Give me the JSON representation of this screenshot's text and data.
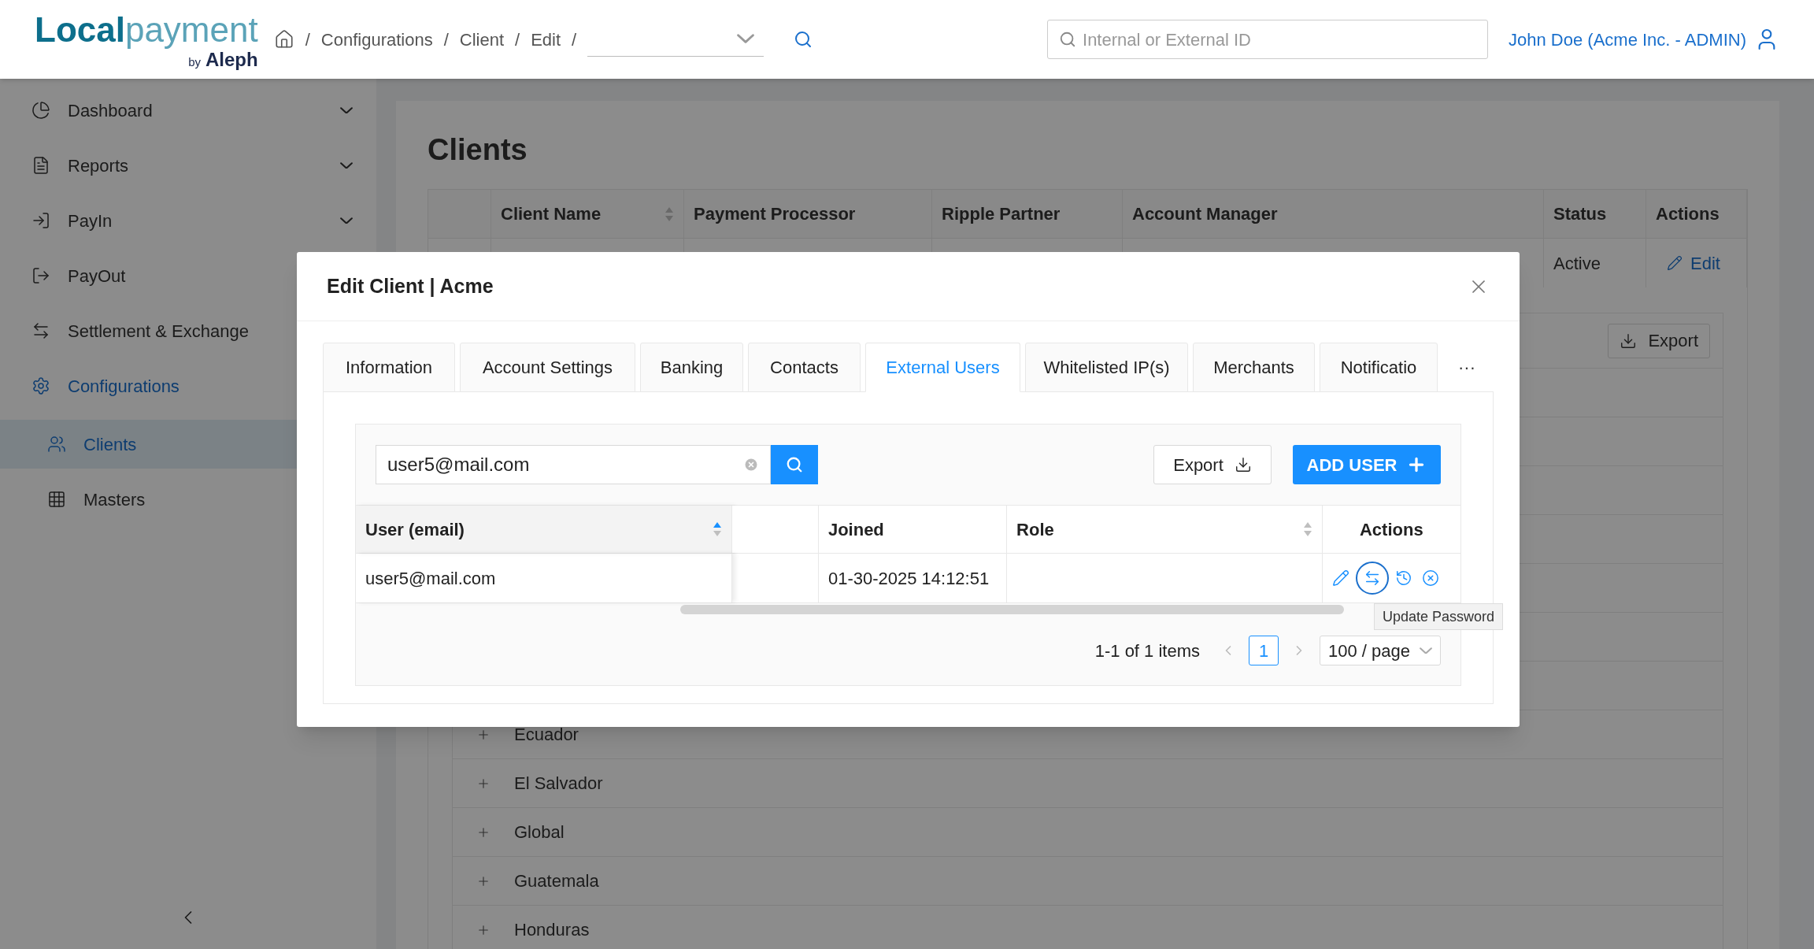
{
  "header": {
    "logo": {
      "word_1": "Local",
      "word_2": "payment",
      "by": "by",
      "brand": "Aleph"
    },
    "breadcrumb": [
      {
        "kind": "home",
        "separator": "/"
      },
      {
        "kind": "text",
        "label": "Configurations",
        "separator": "/"
      },
      {
        "kind": "text",
        "label": "Client",
        "separator": "/"
      },
      {
        "kind": "text",
        "label": "Edit",
        "separator": "/"
      }
    ],
    "global_search": {
      "placeholder": "Internal or External ID"
    },
    "user": "John Doe (Acme Inc. - ADMIN)"
  },
  "sidebar": {
    "items": [
      {
        "label": "Dashboard",
        "kind": "submenu",
        "selected": false
      },
      {
        "label": "Reports",
        "kind": "submenu",
        "selected": false
      },
      {
        "label": "PayIn",
        "kind": "submenu",
        "selected": false
      },
      {
        "label": "PayOut",
        "kind": "link",
        "selected": false
      },
      {
        "label": "Settlement & Exchange",
        "kind": "link",
        "selected": false
      },
      {
        "label": "Configurations",
        "kind": "group",
        "selected": true,
        "children": [
          {
            "label": "Clients",
            "selected": true
          },
          {
            "label": "Masters",
            "selected": false
          }
        ]
      }
    ]
  },
  "page": {
    "title": "Clients",
    "columns": [
      {
        "label": "Client Name",
        "sortable": true
      },
      {
        "label": "Payment Processor",
        "sortable": false
      },
      {
        "label": "Ripple Partner",
        "sortable": false
      },
      {
        "label": "Account Manager",
        "sortable": false
      },
      {
        "label": "Status",
        "sortable": false
      },
      {
        "label": "Actions",
        "sortable": false
      }
    ],
    "row": {
      "status": "Active",
      "action": "Edit"
    },
    "export_button": "Export",
    "countries": [
      "Ecuador",
      "El Salvador",
      "Global",
      "Guatemala",
      "Honduras"
    ]
  },
  "modal": {
    "title": "Edit Client | Acme",
    "tabs": [
      {
        "label": "Information",
        "selected": false
      },
      {
        "label": "Account Settings",
        "selected": false
      },
      {
        "label": "Banking",
        "selected": false
      },
      {
        "label": "Contacts",
        "selected": false
      },
      {
        "label": "External Users",
        "selected": true
      },
      {
        "label": "Whitelisted IP(s)",
        "selected": false
      },
      {
        "label": "Merchants",
        "selected": false
      },
      {
        "label": "Notificatio",
        "selected": false
      }
    ],
    "more_tabs": "···",
    "search": {
      "value": "user5@mail.com"
    },
    "export_button": "Export",
    "add_button": "ADD USER",
    "columns": [
      {
        "kind": "text",
        "label": "User (email)",
        "sortable": true,
        "sorted": true
      },
      {
        "kind": "blank"
      },
      {
        "kind": "text",
        "label": "Joined"
      },
      {
        "kind": "text",
        "label": "Role",
        "sortable": true,
        "sorted": false
      },
      {
        "kind": "text",
        "label": "Actions"
      }
    ],
    "rows": [
      {
        "email": "user5@mail.com",
        "joined": "01-30-2025 14:12:51",
        "actions": [
          {
            "hovered": false
          },
          {
            "hovered": true
          },
          {
            "hovered": false
          },
          {
            "hovered": false
          }
        ]
      }
    ],
    "tooltip": "Update Password",
    "pagination": {
      "summary": "1-1 of 1 items",
      "pages": [
        {
          "label": "1",
          "selected": true
        }
      ],
      "page_size": "100 / page"
    }
  }
}
